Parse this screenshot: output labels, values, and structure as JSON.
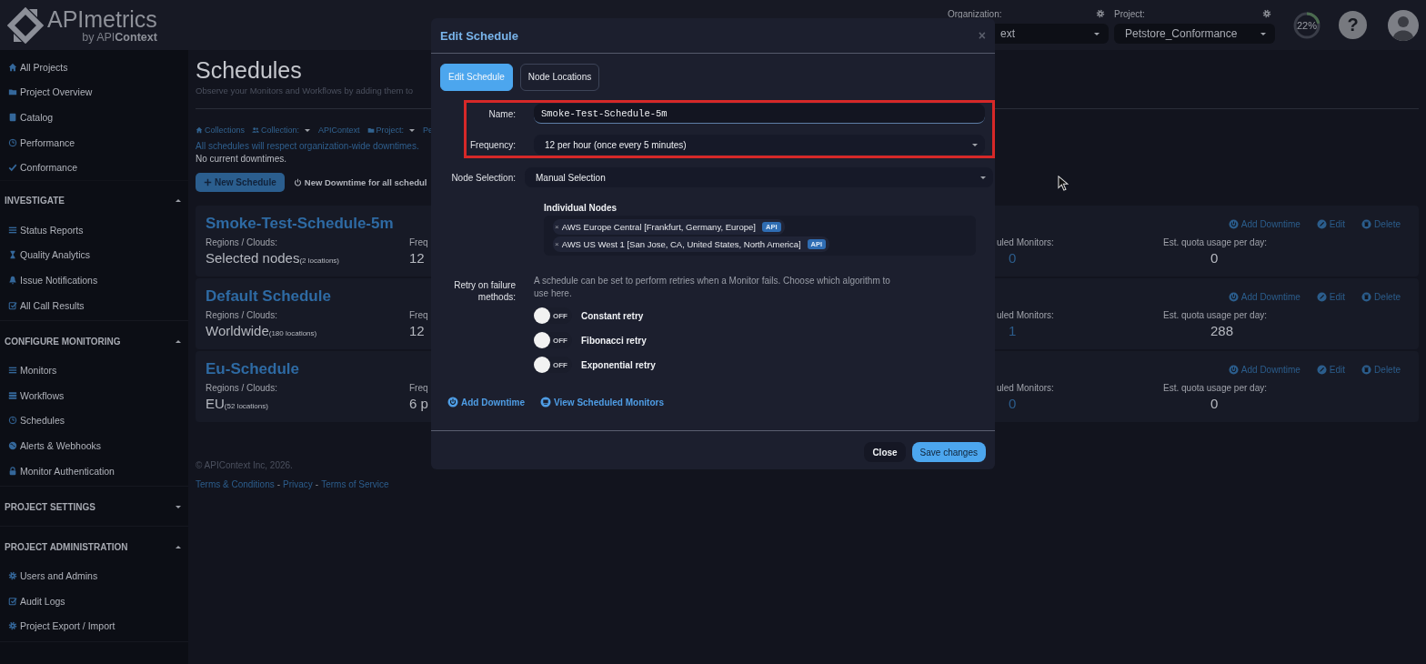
{
  "header": {
    "logo": {
      "name": "APImetrics",
      "tagline": "by API**Context**"
    },
    "organization": {
      "label": "Organization:",
      "value": "ext"
    },
    "project": {
      "label": "Project:",
      "value": "Petstore_Conformance"
    },
    "usage": {
      "level": 0.22,
      "reading": "22%"
    },
    "help": "?"
  },
  "sidebar": {
    "items": [
      {
        "label": "All Projects"
      },
      {
        "label": "Project Overview"
      },
      {
        "label": "Catalog"
      },
      {
        "label": "Performance"
      },
      {
        "label": "Conformance"
      }
    ],
    "sections": [
      {
        "title": "INVESTIGATE",
        "expanded": true,
        "items": [
          {
            "label": "Status Reports"
          },
          {
            "label": "Quality Analytics"
          },
          {
            "label": "Issue Notifications"
          },
          {
            "label": "All Call Results"
          }
        ]
      },
      {
        "title": "CONFIGURE MONITORING",
        "expanded": true,
        "items": [
          {
            "label": "Monitors"
          },
          {
            "label": "Workflows"
          },
          {
            "label": "Schedules"
          },
          {
            "label": "Alerts & Webhooks"
          },
          {
            "label": "Monitor Authentication"
          }
        ]
      },
      {
        "title": "PROJECT SETTINGS",
        "expanded": false
      },
      {
        "title": "PROJECT ADMINISTRATION",
        "expanded": true,
        "items": [
          {
            "label": "Users and Admins"
          },
          {
            "label": "Audit Logs"
          },
          {
            "label": "Project Export / Import"
          }
        ]
      }
    ]
  },
  "page": {
    "title": "Schedules",
    "subtitle": "Observe your Monitors and Workflows by adding them to",
    "breadcrumb": [
      {
        "label": "Collections"
      },
      {
        "label": "Collection:",
        "value": "APIContext"
      },
      {
        "label": "Project:",
        "value": "Pe"
      }
    ],
    "notice": "All schedules will respect organization-wide downtimes.",
    "downtime_status": "No current downtimes.",
    "buttons": [
      {
        "kind": "primary",
        "label": "New Schedule"
      },
      {
        "kind": "plain",
        "label": "New Downtime for all schedul"
      }
    ],
    "schedules": [
      {
        "title": "Smoke-Test-Schedule-5m",
        "regions_label": "Regions / Clouds:",
        "regions": "Selected nodes",
        "locations": "(2 locations)",
        "frequency_label": "Freq",
        "frequency": "12",
        "monitors_label": "uled Monitors:",
        "monitors": "0",
        "quota_label": "Est. quota usage per day:",
        "quota": "0",
        "actions": [
          "Add Downtime",
          "Edit",
          "Delete"
        ]
      },
      {
        "title": "Default Schedule",
        "regions_label": "Regions / Clouds:",
        "regions": "Worldwide",
        "locations": "(180 locations)",
        "frequency_label": "Freq",
        "frequency": "12",
        "monitors_label": "uled Monitors:",
        "monitors": "1",
        "quota_label": "Est. quota usage per day:",
        "quota": "288",
        "actions": [
          "Add Downtime",
          "Edit",
          "Delete"
        ]
      },
      {
        "title": "Eu-Schedule",
        "regions_label": "Regions / Clouds:",
        "regions": "EU",
        "locations": "(52 locations)",
        "frequency_label": "Freq",
        "frequency": "6 p",
        "monitors_label": "uled Monitors:",
        "monitors": "0",
        "quota_label": "Est. quota usage per day:",
        "quota": "0",
        "actions": [
          "Add Downtime",
          "Edit",
          "Delete"
        ]
      }
    ],
    "footer": {
      "copyright": "© APIContext Inc, 2026.",
      "links": [
        "Terms & Conditions",
        "Privacy",
        "Terms of Service"
      ],
      "separator": "-"
    }
  },
  "modal": {
    "title": "Edit Schedule",
    "close": "×",
    "tabs": [
      {
        "label": "Edit Schedule",
        "selected": true
      },
      {
        "label": "Node Locations",
        "selected": false
      }
    ],
    "form_groups": [
      {
        "highlighted": true,
        "fields": [
          {
            "kind": "text",
            "label": "Name:",
            "value": "Smoke-Test-Schedule-5m"
          },
          {
            "kind": "select",
            "label": "Frequency:",
            "value": "12 per hour (once every 5 minutes)"
          }
        ]
      },
      {
        "highlighted": false,
        "fields": [
          {
            "kind": "select",
            "label": "Node Selection:",
            "value": "Manual Selection"
          }
        ]
      }
    ],
    "nodes": {
      "title": "Individual Nodes",
      "items": [
        {
          "remove": "×",
          "label": "AWS Europe Central [Frankfurt, Germany, Europe]",
          "tag": "API"
        },
        {
          "remove": "×",
          "label": "AWS US West 1 [San Jose, CA, United States, North America]",
          "tag": "API"
        }
      ]
    },
    "retry": {
      "label": "Retry on failure methods:",
      "description": "A schedule can be set to perform retries when a Monitor fails. Choose which algorithm to use here.",
      "options": [
        {
          "label": "Constant retry",
          "on": false,
          "state_text": "OFF"
        },
        {
          "label": "Fibonacci retry",
          "on": false,
          "state_text": "OFF"
        },
        {
          "label": "Exponential retry",
          "on": false,
          "state_text": "OFF"
        }
      ]
    },
    "links": [
      "Add Downtime",
      "View Scheduled Monitors"
    ],
    "buttons": [
      {
        "kind": "secondary",
        "label": "Close"
      },
      {
        "kind": "primary",
        "label": "Save changes"
      }
    ]
  }
}
